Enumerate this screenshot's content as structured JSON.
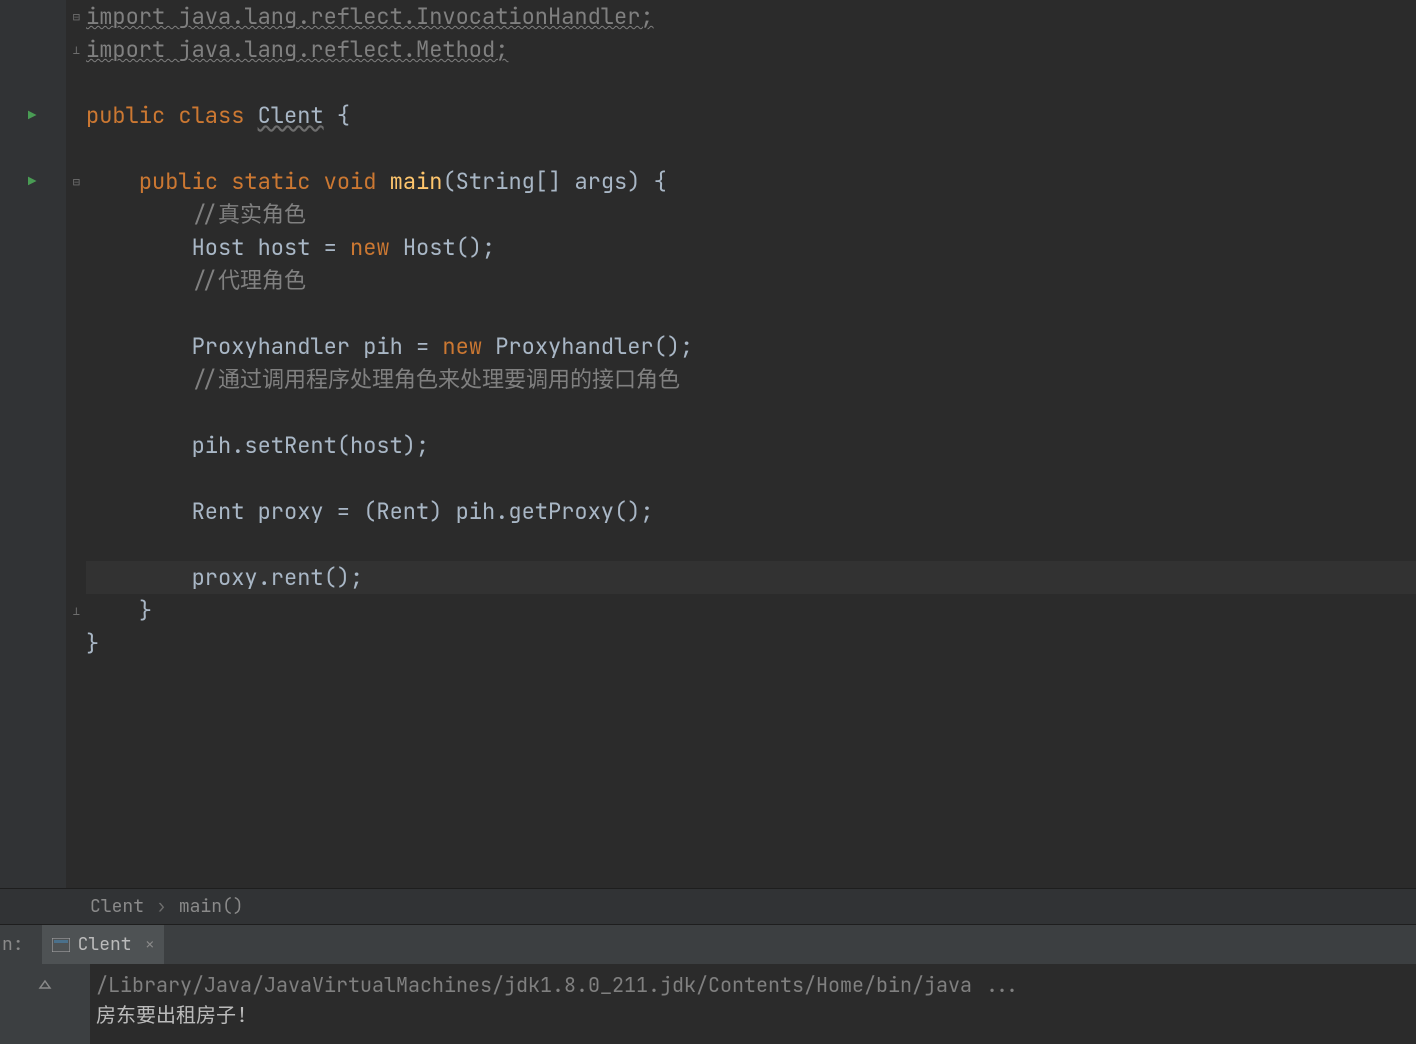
{
  "code": {
    "import1": "import java.lang.reflect.InvocationHandler;",
    "import2": "import java.lang.reflect.Method;",
    "class_kw": "public class ",
    "class_name": "Clent",
    "class_brace": " {",
    "main_sig_pub": "public static ",
    "main_sig_void": "void ",
    "main_sig_name": "main",
    "main_sig_args": "(String[] args) {",
    "comment1": "//真实角色",
    "host_line_a": "Host host = ",
    "host_line_new": "new",
    "host_line_b": " Host();",
    "comment2": "//代理角色",
    "proxy_a": "Proxyhandler pih = ",
    "proxy_new": "new",
    "proxy_b": " Proxyhandler();",
    "comment3": "//通过调用程序处理角色来处理要调用的接口角色",
    "setrent": "pih.setRent(host);",
    "rent_a": "Rent proxy = (Rent) pih.getProxy();",
    "proxyrent": "proxy.rent();",
    "close1": "}",
    "close2": "}"
  },
  "breadcrumb": {
    "class": "Clent",
    "method": "main()"
  },
  "run": {
    "label": "n:",
    "tab_name": "Clent"
  },
  "console": {
    "path": "/Library/Java/JavaVirtualMachines/jdk1.8.0_211.jdk/Contents/Home/bin/java ...",
    "out1": "房东要出租房子!"
  }
}
